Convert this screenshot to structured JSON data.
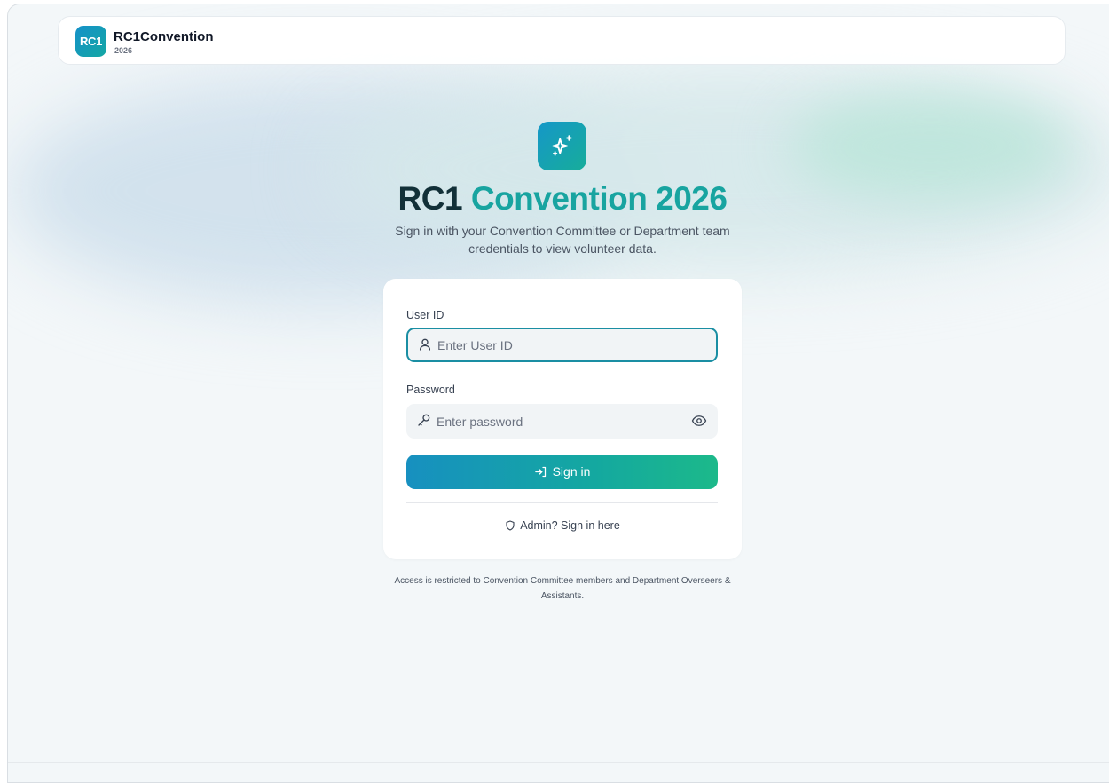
{
  "header": {
    "logo_text": "RC1",
    "brand_name": "RC1Convention",
    "brand_year": "2026"
  },
  "hero": {
    "icon": "sparkles-icon",
    "title_part1": "RC1",
    "title_part2": "Convention 2026",
    "subtitle": "Sign in with your Convention Committee or Department team credentials to view volunteer data."
  },
  "form": {
    "user_id_label": "User ID",
    "user_id_placeholder": "Enter User ID",
    "user_id_value": "",
    "password_label": "Password",
    "password_placeholder": "Enter password",
    "password_value": "",
    "signin_label": "Sign in",
    "admin_link_label": "Admin? Sign in here"
  },
  "footer_note": "Access is restricted to Convention Committee members and Department Overseers & Assistants.",
  "colors": {
    "accent": "#18a4a0",
    "primary_blue": "#1590c9",
    "dark_text": "#123038"
  }
}
